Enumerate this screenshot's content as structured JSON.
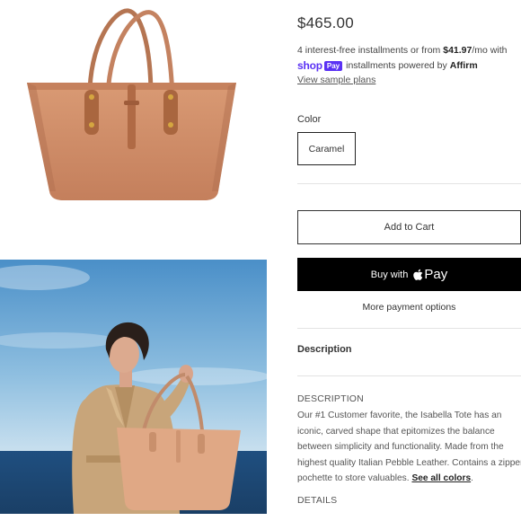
{
  "product": {
    "price": "$465.00",
    "installments_prefix": "4 interest-free installments or from ",
    "installments_amount": "$41.97",
    "installments_suffix": "/mo with",
    "shop_word": "shop",
    "pay_badge": "Pay",
    "installments_powered": "installments powered by",
    "affirm": "Affirm",
    "sample_plans": "View sample plans",
    "color_label": "Color",
    "color_option": "Caramel",
    "add_to_cart": "Add to Cart",
    "buy_with": "Buy with",
    "apple_pay": "Pay",
    "more_payment": "More payment options",
    "description_heading": "Description",
    "description_title": "DESCRIPTION",
    "description_lines": [
      "Our #1 Customer favorite, the Isabella Tote has an",
      "iconic, carved shape that epitomizes the balance",
      "between simplicity and functionality. Made from the",
      "highest quality Italian Pebble Leather. Contains a zipper",
      "pochette to store valuables."
    ],
    "see_all_colors": "See all colors",
    "details_title": "DETAILS"
  },
  "colors": {
    "bag": "#c98a66",
    "shop_pay_purple": "#5a31f4",
    "button_black": "#000000"
  },
  "icons": {
    "apple": "apple-icon"
  }
}
